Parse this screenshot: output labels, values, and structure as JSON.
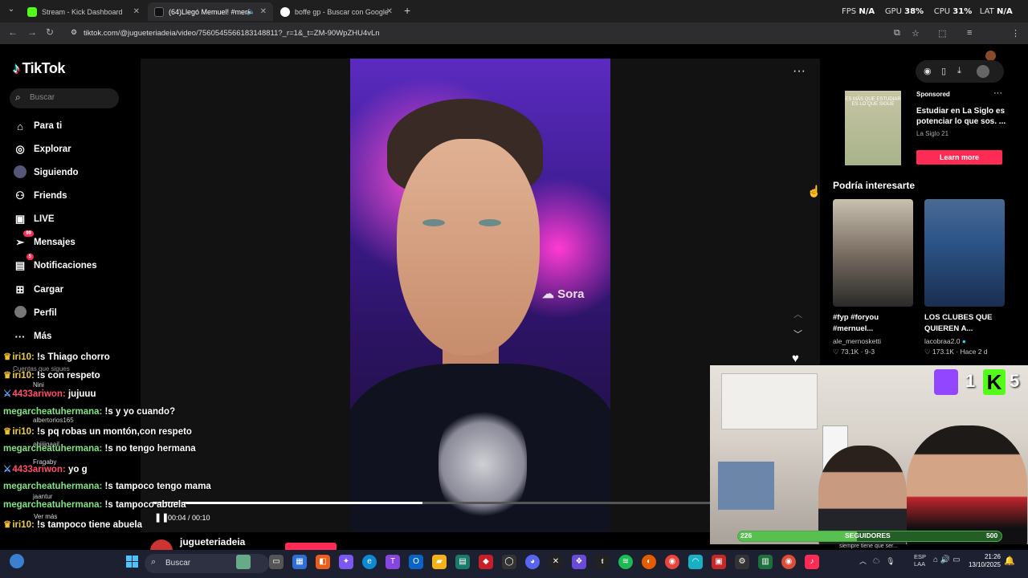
{
  "browser": {
    "tabs": [
      {
        "title": "Stream - Kick Dashboard",
        "favicon_color": "#53fc18"
      },
      {
        "title": "(64)Llegó Memuel! #mernu",
        "favicon_color": "#111111"
      },
      {
        "title": "boffe gp - Buscar con Google",
        "favicon_color": "#4285f4"
      }
    ],
    "url": "tiktok.com/@jugueteriadeia/video/7560545566183148811?_r=1&_t=ZM-90WpZHU4vLn",
    "perf": {
      "fps_label": "FPS",
      "fps": "N/A",
      "gpu_label": "GPU",
      "gpu": "38%",
      "cpu_label": "CPU",
      "cpu": "31%",
      "lat_label": "LAT",
      "lat": "N/A"
    }
  },
  "sidebar": {
    "logo": "TikTok",
    "search_placeholder": "Buscar",
    "items": [
      {
        "label": "Para ti",
        "icon": "home-icon"
      },
      {
        "label": "Explorar",
        "icon": "compass-icon"
      },
      {
        "label": "Siguiendo",
        "icon": "avatar-icon"
      },
      {
        "label": "Friends",
        "icon": "friends-icon"
      },
      {
        "label": "LIVE",
        "icon": "live-icon"
      },
      {
        "label": "Mensajes",
        "icon": "paper-plane-icon",
        "badge": "99"
      },
      {
        "label": "Notificaciones",
        "icon": "inbox-icon",
        "badge": "5"
      },
      {
        "label": "Cargar",
        "icon": "plus-square-icon"
      },
      {
        "label": "Perfil",
        "icon": "profile-icon"
      },
      {
        "label": "Más",
        "icon": "more-icon"
      }
    ],
    "following_header": "Cuentas que sigues",
    "following": [
      {
        "name": "Nini"
      },
      {
        "name": "albertorios165"
      },
      {
        "name": "abiiijgaail"
      },
      {
        "name": "Fragaby"
      },
      {
        "name": "jaantur"
      }
    ],
    "see_more": "Ver más"
  },
  "video": {
    "watermark": "Sora",
    "time": "00:04 / 00:10",
    "progress": 0.48,
    "author": "jugueteriadeia"
  },
  "ad": {
    "sponsored": "Sponsored",
    "thumb_text": "ES MÁS QUE ESTUDIAR ES LO QUE SIGUE",
    "title": "Estudiar en La Siglo es potenciar lo que sos. ...",
    "advertiser": "La Siglo 21",
    "cta": "Learn more"
  },
  "recommend": {
    "header": "Podría interesarte",
    "items": [
      {
        "title": "#fyp #foryou #mernuel...",
        "author": "ale_mernosketti",
        "likes": "73.1K",
        "date": "9-3"
      },
      {
        "title": "LOS CLUBES QUE QUIEREN A...",
        "author": "lacobraa2.0",
        "likes": "173.1K",
        "date": "Hace 2 d"
      }
    ]
  },
  "overlay": {
    "twitch_count": "1",
    "kick_count": "5",
    "followers_current": "226",
    "followers_label": "SEGUIDORES",
    "followers_goal": "500",
    "followers_progress": 0.452,
    "caption": "siempre tiene que ser..."
  },
  "chat": [
    {
      "user": "iri10:",
      "msg": " !s Thiago chorro",
      "color": "y",
      "crown": true
    },
    {
      "user": "iri10:",
      "msg": " !s con respeto",
      "color": "y",
      "crown": true
    },
    {
      "user": "4433ariwon:",
      "msg": " jujuuu",
      "color": "r",
      "crown": false
    },
    {
      "user": "megarcheatuhermana:",
      "msg": " !s y yo cuando?",
      "color": "g",
      "crown": false
    },
    {
      "user": "iri10:",
      "msg": " !s pq robas un montón,con respeto",
      "color": "y",
      "crown": true
    },
    {
      "user": "megarcheatuhermana:",
      "msg": " !s no tengo hermana",
      "color": "g",
      "crown": false
    },
    {
      "user": "4433ariwon:",
      "msg": " yo g",
      "color": "r",
      "crown": false
    },
    {
      "user": "megarcheatuhermana:",
      "msg": " !s tampoco tengo mama",
      "color": "g",
      "crown": false
    },
    {
      "user": "megarcheatuhermana:",
      "msg": " !s tampoco abuela",
      "color": "g",
      "crown": false
    },
    {
      "user": "iri10:",
      "msg": " !s tampoco tiene abuela",
      "color": "y",
      "crown": true
    }
  ],
  "taskbar": {
    "search_placeholder": "Buscar",
    "lang": "ESP",
    "lang2": "LAA",
    "time": "21:26",
    "date": "13/10/2025"
  }
}
